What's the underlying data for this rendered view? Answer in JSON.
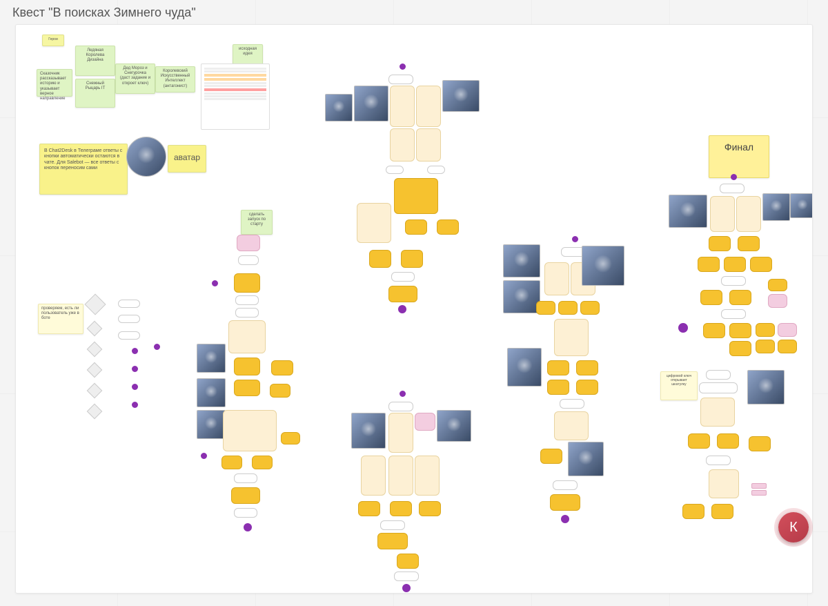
{
  "title": "Квест \"В поисках Зимнего чуда\"",
  "stickies": {
    "heroes_label": "Герои",
    "narrator": "Сказочник рассказывает историю и указывает верное направление",
    "ice_queen": "Ледяная Королева Дизайна",
    "snow_knight": "Снежный Рыцарь IT",
    "ded_moroz": "Дед Мороз и Снегурочка (даст задание и откроет ключ)",
    "ai_queen": "Королевский Искусственный Интеллект (антагонист)",
    "source_idea": "исходная идея",
    "chat2desk_note": "В Chat2Desk в Телеграме ответы с кнопки автоматически остаются в чате. Для Salebot — все ответы с кнопок переносим сами",
    "avatar": "аватар",
    "make_start": "сделать запуск по старту",
    "check_user": "проверяем, есть ли пользователь уже в боте",
    "digital_key": "цифровой ключ открывает шкатулку",
    "final": "Финал"
  },
  "fab_label": "К"
}
